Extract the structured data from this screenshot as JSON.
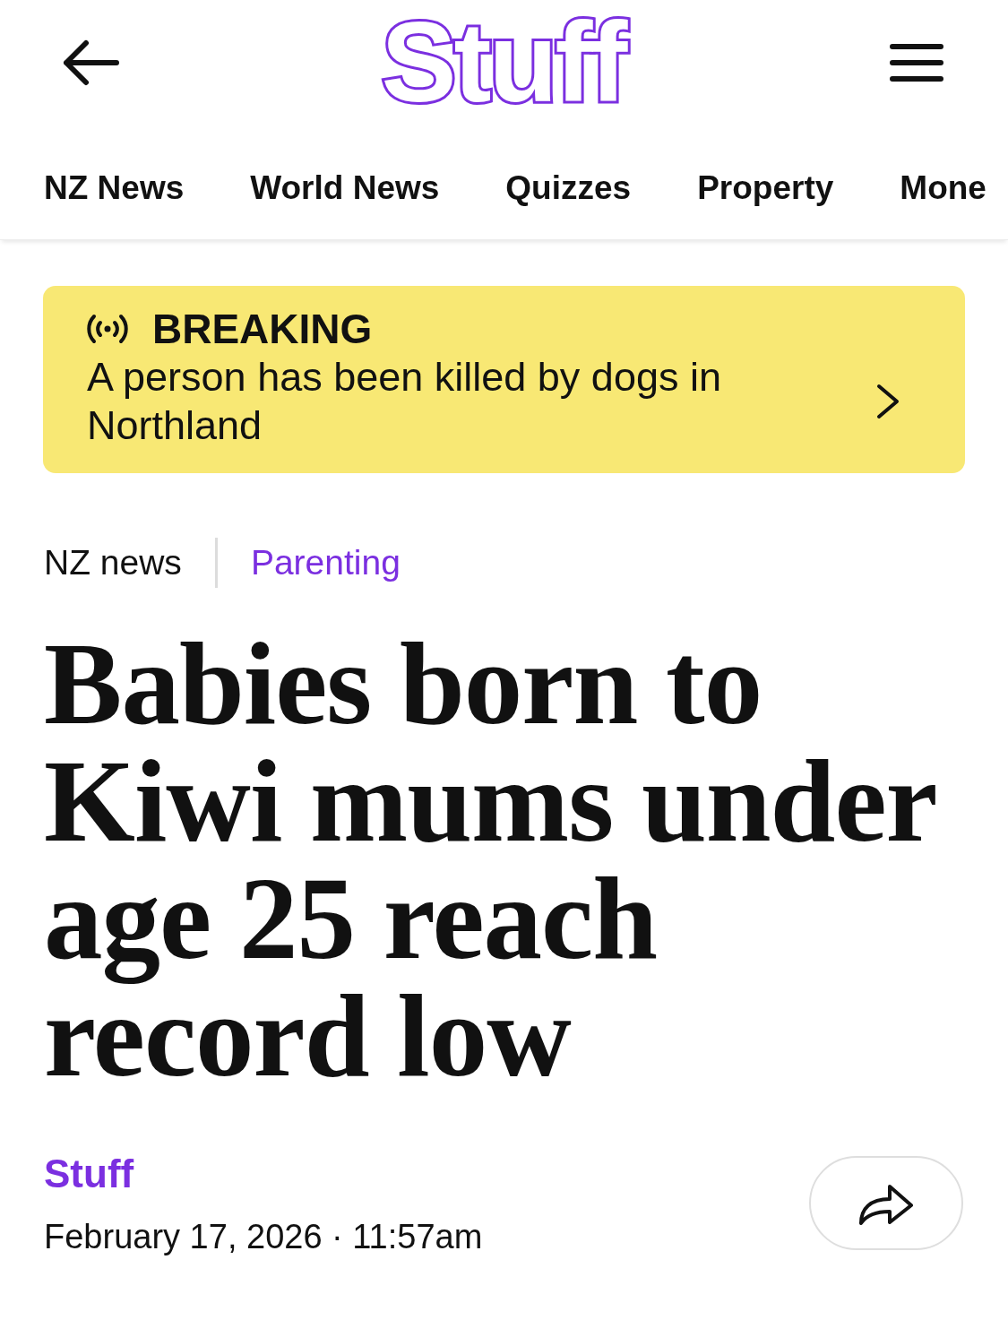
{
  "header": {
    "logo": "Stuff"
  },
  "nav": {
    "tabs": [
      "NZ News",
      "World News",
      "Quizzes",
      "Property",
      "Mone"
    ]
  },
  "breaking": {
    "label": "BREAKING",
    "headline": "A person has been killed by dogs in Northland"
  },
  "categories": [
    {
      "label": "NZ news",
      "kind": "section"
    },
    {
      "label": "Parenting",
      "kind": "topic"
    }
  ],
  "article": {
    "headline": "Babies born to Kiwi mums under age 25 reach record low",
    "author": "Stuff",
    "dateline": "February 17, 2026 · 11:57am"
  }
}
